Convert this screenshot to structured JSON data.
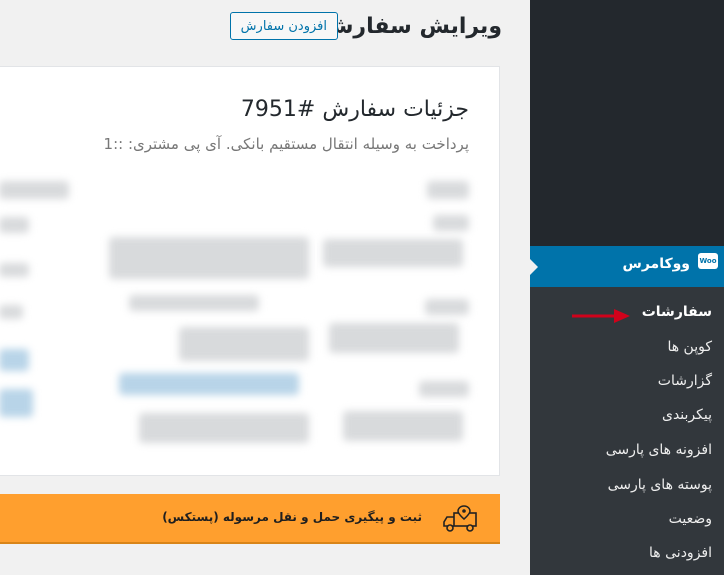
{
  "page": {
    "title": "ویرایش سفارش",
    "add_button": "افزودن سفارش"
  },
  "order": {
    "heading": "جزئیات سفارش #7951",
    "meta": "پرداخت به وسیله انتقال مستقیم بانکی. آی پی مشتری: ::1"
  },
  "sidebar": {
    "menu_label": "ووکامرس",
    "logo_text": "Woo",
    "submenu": [
      {
        "label": "سفارشات",
        "current": true
      },
      {
        "label": "کوپن ها",
        "current": false
      },
      {
        "label": "گزارشات",
        "current": false
      },
      {
        "label": "پیکربندی",
        "current": false
      },
      {
        "label": "افزونه های پارسی",
        "current": false
      },
      {
        "label": "پوسته های پارسی",
        "current": false
      },
      {
        "label": "وضعیت",
        "current": false
      },
      {
        "label": "افزودنی ها",
        "current": false
      }
    ]
  },
  "shipping_banner": {
    "label": "ثبت و پیگیری حمل و نقل مرسوله (پستکس)"
  },
  "colors": {
    "sidebar_bg": "#23282d",
    "submenu_bg": "#32373c",
    "accent": "#0073aa",
    "banner": "#ff9f2e",
    "annotation_arrow": "#d0021b"
  },
  "icons": {
    "woo_logo": "woocommerce-logo-icon",
    "truck": "delivery-truck-icon",
    "annotation": "red-arrow-icon"
  }
}
